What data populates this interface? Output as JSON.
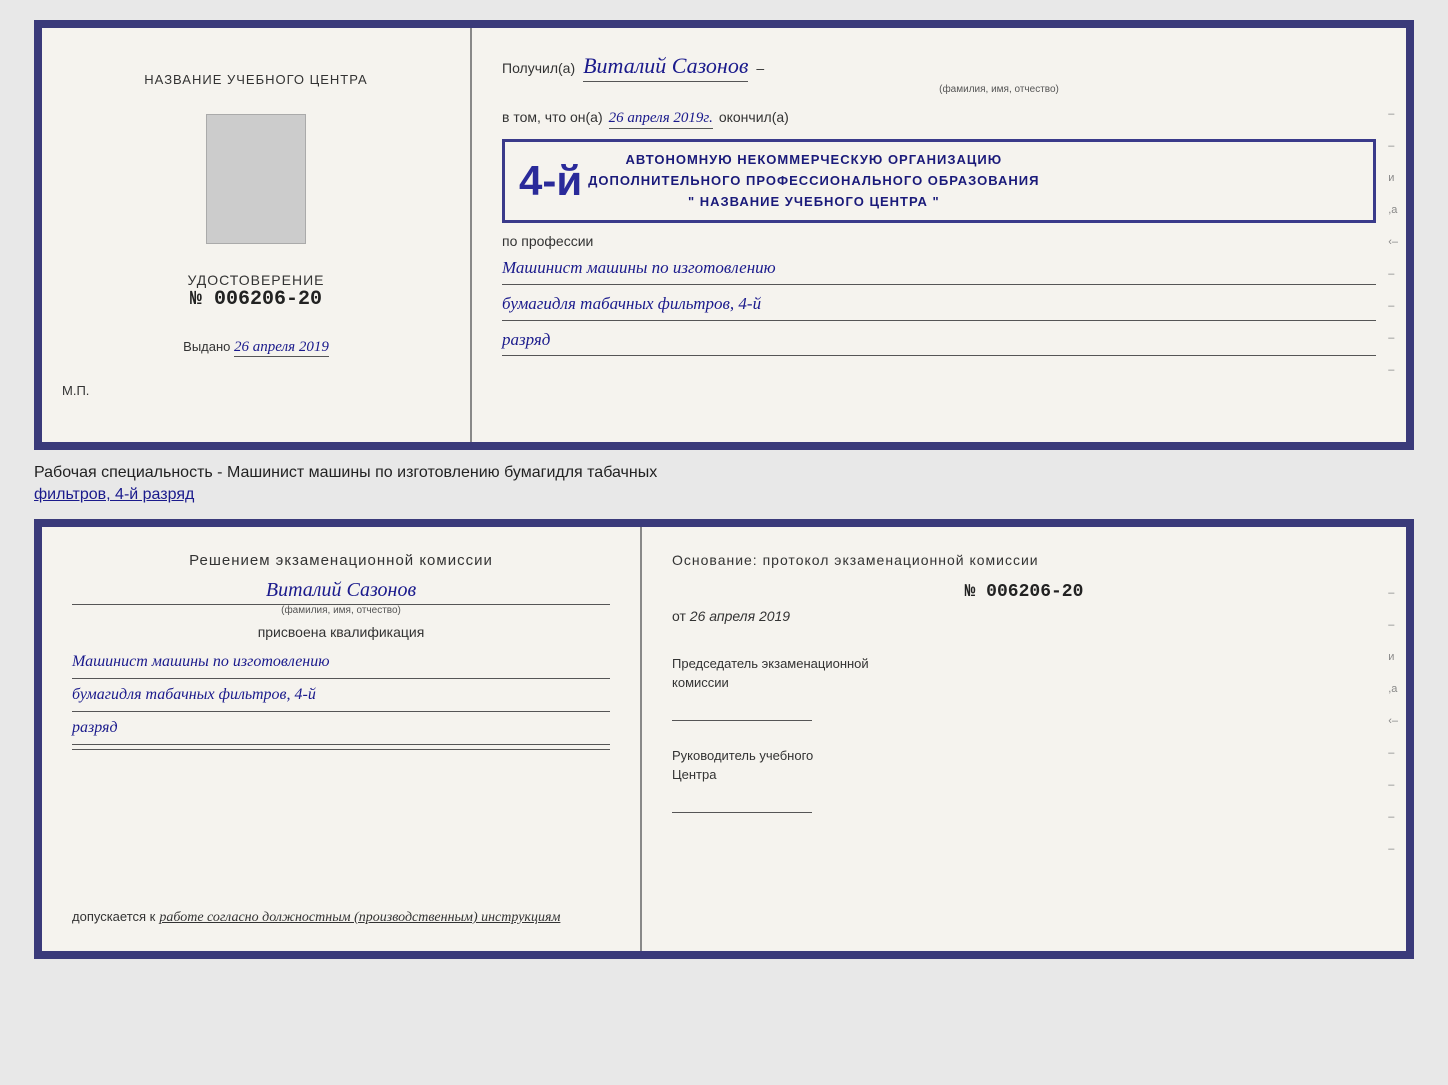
{
  "top_cert": {
    "left": {
      "school_name_label": "НАЗВАНИЕ УЧЕБНОГО ЦЕНТРА",
      "udostoverenie_title": "УДОСТОВЕРЕНИЕ",
      "number": "№ 006206-20",
      "vydano_prefix": "Выдано",
      "vydano_date": "26 апреля 2019",
      "mp_label": "М.П."
    },
    "right": {
      "poluchil_label": "Получил(а)",
      "name_handwritten": "Виталий Сазонов",
      "fio_subtitle": "(фамилия, имя, отчество)",
      "dash": "–",
      "vtom_label": "в том, что он(а)",
      "date_handwritten": "26 апреля 2019г.",
      "okончил_label": "окончил(а)",
      "stamp_number": "4-й",
      "stamp_line1": "АВТОНОМНУЮ НЕКОММЕРЧЕСКУЮ ОРГАНИЗАЦИЮ",
      "stamp_line2": "ДОПОЛНИТЕЛЬНОГО ПРОФЕССИОНАЛЬНОГО ОБРАЗОВАНИЯ",
      "stamp_line3": "\" НАЗВАНИЕ УЧЕБНОГО ЦЕНТРА \"",
      "po_professii": "по профессии",
      "profession_line1": "Машинист машины по изготовлению",
      "profession_line2": "бумагидля табачных фильтров, 4-й",
      "profession_line3": "разряд"
    }
  },
  "between": {
    "text": "Рабочая специальность - Машинист машины по изготовлению бумагидля табачных",
    "text2": "фильтров, 4-й разряд"
  },
  "bottom_cert": {
    "left": {
      "resheniem": "Решением  экзаменационной  комиссии",
      "name_handwritten": "Виталий Сазонов",
      "fio_subtitle": "(фамилия, имя, отчество)",
      "prisvoyena": "присвоена квалификация",
      "qual_line1": "Машинист машины по изготовлению",
      "qual_line2": "бумагидля табачных фильтров, 4-й",
      "qual_line3": "разряд",
      "dopuskaetsya_label": "допускается к",
      "dopusk_text": "работе согласно должностным (производственным) инструкциям"
    },
    "right": {
      "osnovanie_label": "Основание: протокол экзаменационной  комиссии",
      "protocol_number": "№  006206-20",
      "ot_prefix": "от",
      "ot_date": "26 апреля 2019",
      "predsedatel_label": "Председатель экзаменационной",
      "predsedatel_label2": "комиссии",
      "rukovoditel_label": "Руководитель учебного",
      "rukovoditel_label2": "Центра"
    }
  }
}
